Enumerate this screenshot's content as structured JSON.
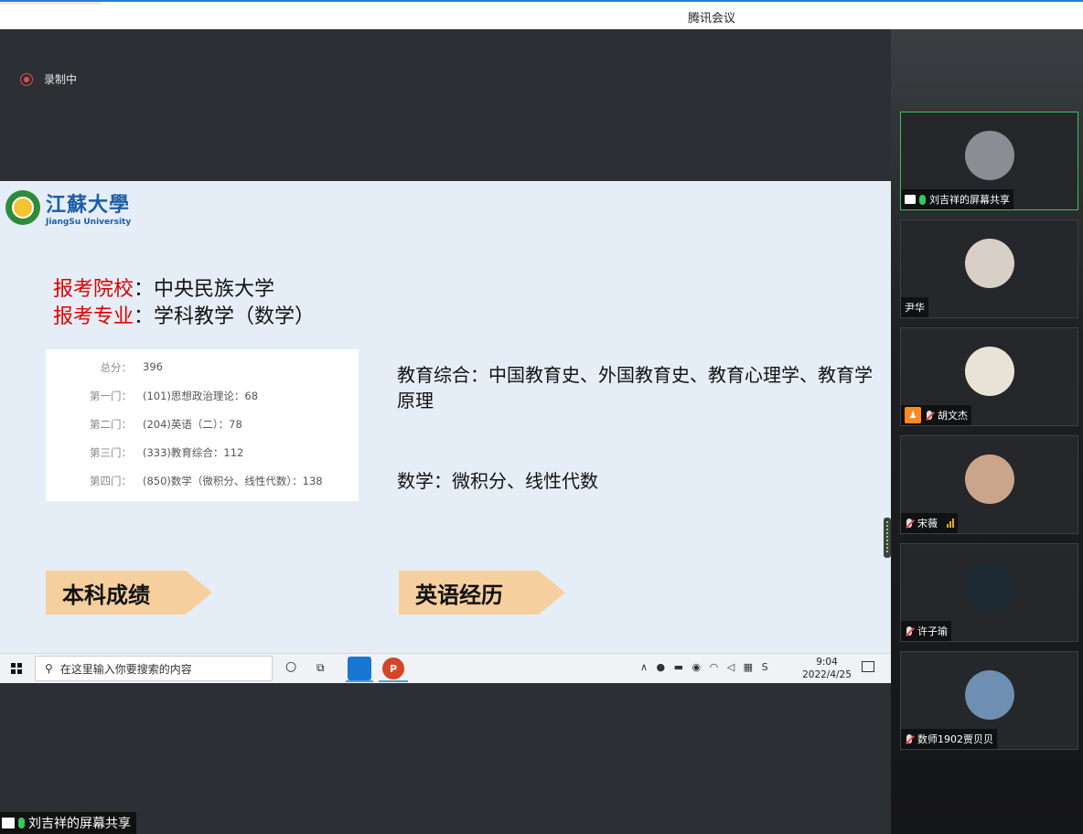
{
  "window": {
    "title": "腾讯会议"
  },
  "recording": {
    "label": "录制中"
  },
  "slide": {
    "logo": {
      "cn": "江蘇大學",
      "en": "JiangSu University"
    },
    "school_label": "报考院校",
    "school_value": "：中央民族大学",
    "major_label": "报考专业",
    "major_value": "：学科教学（数学）",
    "scores": [
      {
        "label": "总分：",
        "value": "396"
      },
      {
        "label": "第一门：",
        "value": "(101)思想政治理论：68"
      },
      {
        "label": "第二门：",
        "value": "(204)英语（二）：78"
      },
      {
        "label": "第三门：",
        "value": "(333)教育综合：112"
      },
      {
        "label": "第四门：",
        "value": "(850)数学（微积分、线性代数）：138"
      }
    ],
    "edu_text": "教育综合：中国教育史、外国教育史、教育心理学、教育学原理",
    "math_text": "数学：微积分、线性代数",
    "button1": "本科成绩",
    "button2": "英语经历"
  },
  "taskbar": {
    "search_placeholder": "在这里输入你要搜索的内容",
    "time": "9:04",
    "date": "2022/4/25",
    "app2_letter": "P"
  },
  "share_label": "刘吉祥的屏幕共享",
  "participants": [
    {
      "name": "刘吉祥的屏幕共享",
      "mic": "on",
      "screen": true,
      "active": true,
      "avatar_color": "#8a8d93"
    },
    {
      "name": "尹华",
      "mic": "none",
      "avatar_color": "#d8cfc6"
    },
    {
      "name": "胡文杰",
      "mic": "off",
      "host": true,
      "avatar_color": "#e9e2d6"
    },
    {
      "name": "宋薇",
      "mic": "off",
      "signal": true,
      "avatar_color": "#caa58a"
    },
    {
      "name": "许子瑜",
      "mic": "off",
      "avatar_color": "#1d2a34"
    },
    {
      "name": "数师1902贾贝贝",
      "mic": "off",
      "avatar_color": "#6e8fb1"
    }
  ]
}
